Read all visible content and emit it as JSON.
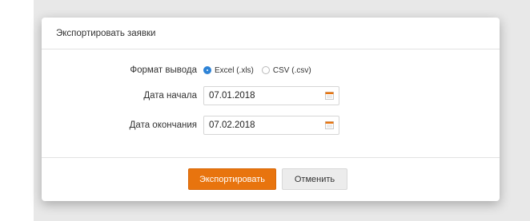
{
  "dialog": {
    "title": "Экспортировать заявки"
  },
  "form": {
    "format": {
      "label": "Формат вывода",
      "options": [
        {
          "label": "Excel (.xls)",
          "checked": true
        },
        {
          "label": "CSV (.csv)",
          "checked": false
        }
      ]
    },
    "start_date": {
      "label": "Дата начала",
      "value": "07.01.2018",
      "icon": "calendar-icon"
    },
    "end_date": {
      "label": "Дата окончания",
      "value": "07.02.2018",
      "icon": "calendar-icon"
    }
  },
  "footer": {
    "export_label": "Экспортировать",
    "cancel_label": "Отменить"
  },
  "colors": {
    "accent": "#e8740e",
    "radio_selected": "#2e83d6"
  }
}
